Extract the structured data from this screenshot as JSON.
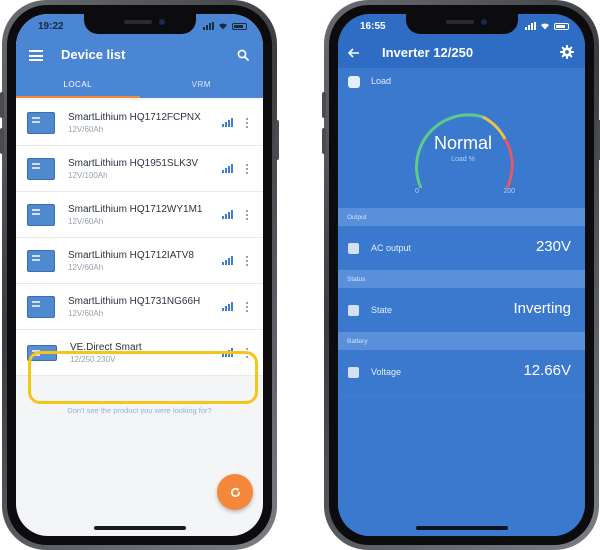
{
  "left_phone": {
    "status": {
      "time": "19:22"
    },
    "header": {
      "title": "Device list"
    },
    "tabs": [
      {
        "label": "LOCAL",
        "active": true
      },
      {
        "label": "VRM",
        "active": false
      }
    ],
    "devices": [
      {
        "name": "SmartLithium HQ1712FCPNX",
        "sub": "12V/60Ah"
      },
      {
        "name": "SmartLithium HQ1951SLK3V",
        "sub": "12V/100Ah"
      },
      {
        "name": "SmartLithium HQ1712WY1M1",
        "sub": "12V/60Ah"
      },
      {
        "name": "SmartLithium HQ1712IATV8",
        "sub": "12V/60Ah"
      },
      {
        "name": "SmartLithium HQ1731NG66H",
        "sub": "12V/60Ah"
      },
      {
        "name": "VE.Direct Smart",
        "sub": "12/250 230V",
        "highlighted": true
      }
    ],
    "missing_link": "Don't see the product you were looking for?",
    "fab_icon": "refresh-icon",
    "colors": {
      "primary": "#4b86d4",
      "accent": "#f5873a",
      "highlight": "#f5c518"
    }
  },
  "right_phone": {
    "status": {
      "time": "16:55"
    },
    "header": {
      "title": "Inverter 12/250"
    },
    "load": {
      "label": "Load",
      "value": "Normal",
      "unit": "Load %",
      "min": "0",
      "max": "200"
    },
    "sections": [
      {
        "title": "Output",
        "label": "AC output",
        "value": "230V"
      },
      {
        "title": "Status",
        "label": "State",
        "value": "Inverting"
      },
      {
        "title": "Battery",
        "label": "Voltage",
        "value": "12.66V"
      }
    ],
    "colors": {
      "background": "#3b79ce",
      "section": "#5a8fda",
      "bar": "#2f6cc4"
    }
  }
}
